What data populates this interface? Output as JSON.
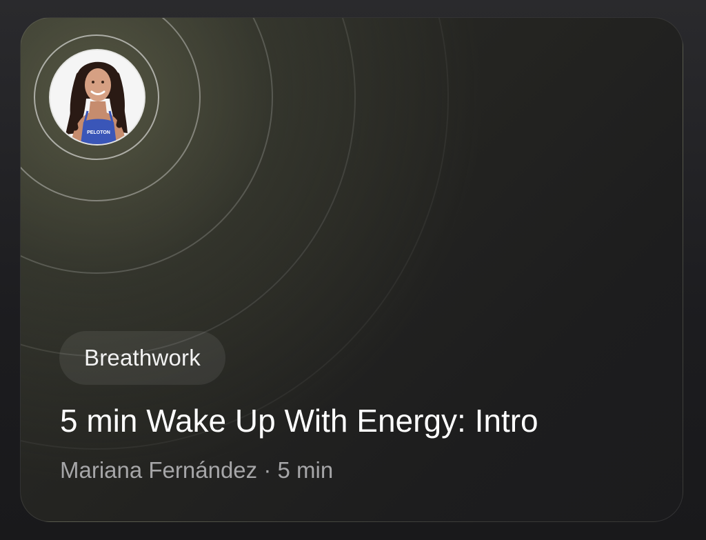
{
  "class_card": {
    "category": "Breathwork",
    "title": "5 min Wake Up With Energy: Intro",
    "instructor": "Mariana Fernández",
    "separator": "·",
    "duration": "5 min",
    "avatar_shirt_text": "PELOTON"
  },
  "colors": {
    "background": "#1c1c1f",
    "card_glow": "#787a5a",
    "title_text": "#ffffff",
    "meta_text": "#a6a6a8",
    "shirt": "#3a56b8"
  },
  "icons": {
    "avatar": "instructor-photo"
  }
}
